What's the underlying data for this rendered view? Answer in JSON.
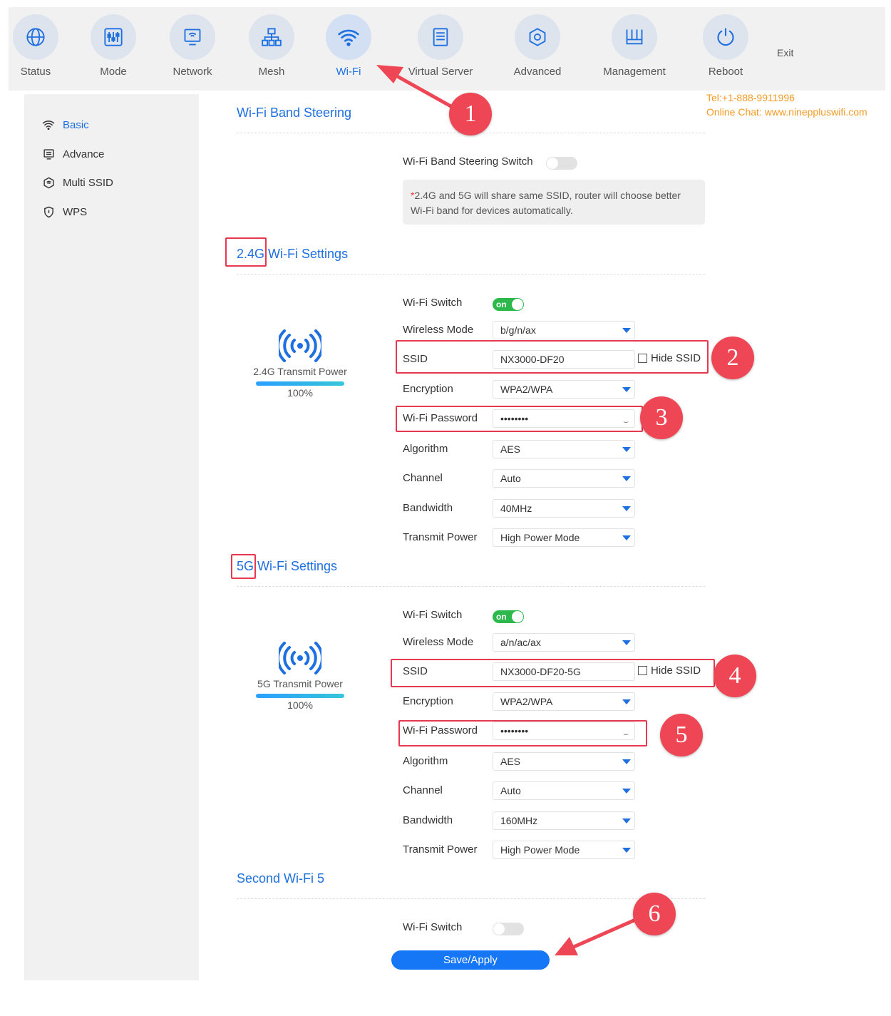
{
  "nav": [
    {
      "label": "Status",
      "icon": "globe-icon"
    },
    {
      "label": "Mode",
      "icon": "sliders-icon"
    },
    {
      "label": "Network",
      "icon": "monitor-icon"
    },
    {
      "label": "Mesh",
      "icon": "mesh-icon"
    },
    {
      "label": "Wi-Fi",
      "icon": "wifi-icon",
      "active": true
    },
    {
      "label": "Virtual Server",
      "icon": "server-icon"
    },
    {
      "label": "Advanced",
      "icon": "hexagon-icon"
    },
    {
      "label": "Management",
      "icon": "router-icon"
    },
    {
      "label": "Reboot",
      "icon": "power-icon"
    }
  ],
  "exit_label": "Exit",
  "contact": {
    "tel": "Tel:+1-888-9911996",
    "chat": "Online Chat: www.nineppluswifi.com"
  },
  "sidebar": [
    {
      "label": "Basic",
      "icon": "wifi-icon",
      "active": true
    },
    {
      "label": "Advance",
      "icon": "monitor-icon"
    },
    {
      "label": "Multi SSID",
      "icon": "multi-ssid-icon"
    },
    {
      "label": "WPS",
      "icon": "shield-icon"
    }
  ],
  "band_steering": {
    "title": "Wi-Fi Band Steering",
    "switch_label": "Wi-Fi Band Steering Switch",
    "switch_on": false,
    "note_star": "*",
    "note": "2.4G and 5G will share same SSID, router will choose better Wi-Fi band for devices automatically."
  },
  "wifi24": {
    "title_band": "2.4G",
    "title_rest": "Wi-Fi Settings",
    "switch_label": "Wi-Fi Switch",
    "switch_text": "on",
    "switch_on": true,
    "mode_label": "Wireless Mode",
    "mode": "b/g/n/ax",
    "ssid_label": "SSID",
    "ssid": "NX3000-DF20",
    "hide_label": "Hide SSID",
    "enc_label": "Encryption",
    "enc": "WPA2/WPA",
    "pwd_label": "Wi-Fi Password",
    "pwd": "••••••••",
    "alg_label": "Algorithm",
    "alg": "AES",
    "ch_label": "Channel",
    "ch": "Auto",
    "bw_label": "Bandwidth",
    "bw": "40MHz",
    "tp_label": "Transmit Power",
    "tp": "High Power Mode",
    "power_label": "2.4G Transmit Power",
    "power_pct": "100%",
    "power_level": 1.0
  },
  "wifi5": {
    "title_band": "5G",
    "title_rest": "Wi-Fi Settings",
    "switch_label": "Wi-Fi Switch",
    "switch_text": "on",
    "switch_on": true,
    "mode_label": "Wireless Mode",
    "mode": "a/n/ac/ax",
    "ssid_label": "SSID",
    "ssid": "NX3000-DF20-5G",
    "hide_label": "Hide SSID",
    "enc_label": "Encryption",
    "enc": "WPA2/WPA",
    "pwd_label": "Wi-Fi Password",
    "pwd": "••••••••",
    "alg_label": "Algorithm",
    "alg": "AES",
    "ch_label": "Channel",
    "ch": "Auto",
    "bw_label": "Bandwidth",
    "bw": "160MHz",
    "tp_label": "Transmit Power",
    "tp": "High Power Mode",
    "power_label": "5G Transmit Power",
    "power_pct": "100%",
    "power_level": 1.0
  },
  "second5": {
    "title": "Second Wi-Fi 5",
    "switch_label": "Wi-Fi Switch",
    "switch_on": false
  },
  "save_label": "Save/Apply",
  "annotations": [
    "1",
    "2",
    "3",
    "4",
    "5",
    "6"
  ],
  "colors": {
    "accent": "#1e6fe0",
    "toggle_on": "#2cb84b",
    "annotation": "#ee4654",
    "contact": "#f59a23"
  }
}
